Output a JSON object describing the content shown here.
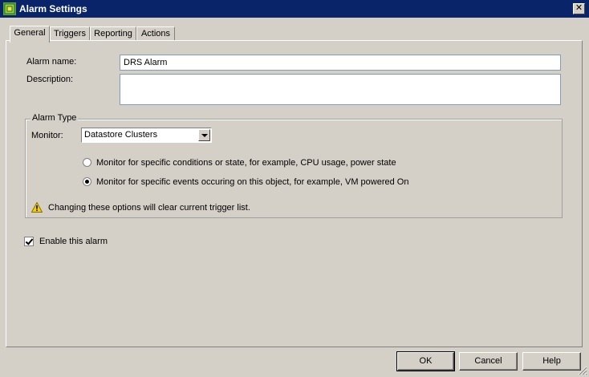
{
  "window": {
    "title": "Alarm Settings",
    "close_glyph": "✕"
  },
  "tabs": [
    {
      "label": "General",
      "active": true
    },
    {
      "label": "Triggers",
      "active": false
    },
    {
      "label": "Reporting",
      "active": false
    },
    {
      "label": "Actions",
      "active": false
    }
  ],
  "general": {
    "alarm_name_label": "Alarm name:",
    "alarm_name_value": "DRS Alarm",
    "description_label": "Description:",
    "description_value": "",
    "alarm_type": {
      "title": "Alarm Type",
      "monitor_label": "Monitor:",
      "monitor_value": "Datastore Clusters",
      "options": [
        {
          "label": "Monitor for specific conditions or state, for example, CPU usage, power state",
          "checked": false
        },
        {
          "label": "Monitor for specific events occuring on this object, for example, VM powered On",
          "checked": true
        }
      ],
      "warning": "Changing these options will clear current trigger list."
    },
    "enable_label": "Enable this alarm",
    "enable_checked": true
  },
  "buttons": {
    "ok": "OK",
    "cancel": "Cancel",
    "help": "Help"
  },
  "colors": {
    "titlebar": "#0a246a",
    "face": "#d4d0c8",
    "warning": "#f5d000"
  },
  "icons": {
    "app": "alarm-app-icon",
    "warning": "warning-triangle-icon",
    "grip": "resize-grip-icon"
  }
}
